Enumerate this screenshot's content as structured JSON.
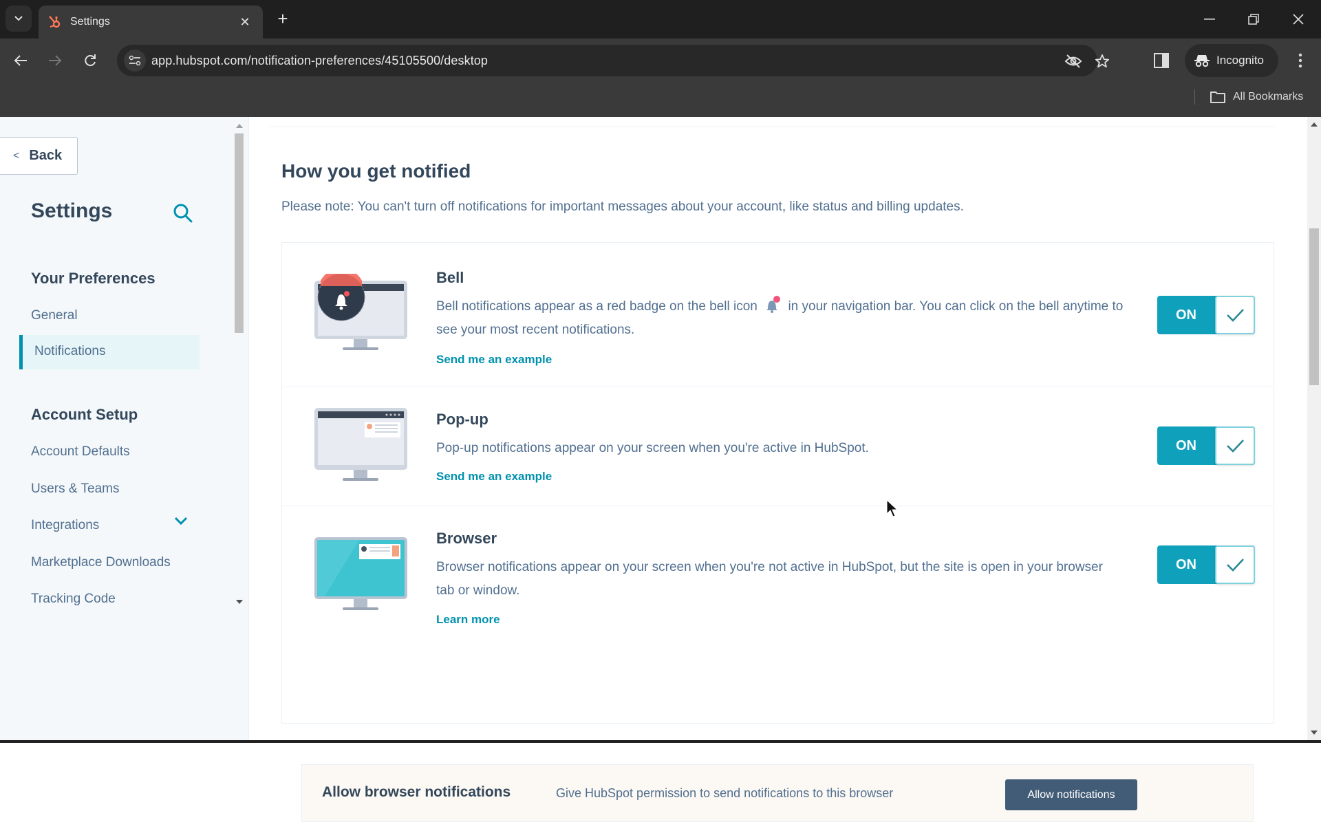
{
  "browser": {
    "tab_title": "Settings",
    "url": "app.hubspot.com/notification-preferences/45105500/desktop",
    "profile_label": "Incognito",
    "bookmarks_label": "All Bookmarks"
  },
  "sidebar": {
    "back_label": "Back",
    "title": "Settings",
    "sections": [
      {
        "label": "Your Preferences",
        "items": [
          {
            "label": "General"
          },
          {
            "label": "Notifications",
            "active": true
          }
        ]
      },
      {
        "label": "Account Setup",
        "items": [
          {
            "label": "Account Defaults"
          },
          {
            "label": "Users & Teams"
          },
          {
            "label": "Integrations",
            "expandable": true
          },
          {
            "label": "Marketplace Downloads"
          },
          {
            "label": "Tracking Code"
          }
        ]
      }
    ]
  },
  "main": {
    "heading": "How you get notified",
    "note": "Please note: You can't turn off notifications for important messages about your account, like status and billing updates.",
    "channels": [
      {
        "title": "Bell",
        "desc_before_icon": "Bell notifications appear as a red badge on the bell icon",
        "desc_after_icon": "in your navigation bar. You can click on the bell anytime to see your most recent notifications.",
        "link": "Send me an example",
        "toggle_label": "ON",
        "enabled": true
      },
      {
        "title": "Pop-up",
        "desc": "Pop-up notifications appear on your screen when you're active in HubSpot.",
        "link": "Send me an example",
        "toggle_label": "ON",
        "enabled": true
      },
      {
        "title": "Browser",
        "desc": "Browser notifications appear on your screen when you're not active in HubSpot, but the site is open in your browser tab or window.",
        "link": "Learn more",
        "toggle_label": "ON",
        "enabled": true
      }
    ],
    "allow_box": {
      "title": "Allow browser notifications",
      "desc": "Give HubSpot permission to send notifications to this browser",
      "button": "Allow notifications"
    }
  },
  "colors": {
    "accent": "#0091ae",
    "toggle_on": "#0fa1bc",
    "text_dark": "#33475b",
    "text_muted": "#516f90",
    "button_dark": "#425b76",
    "hubspot_orange": "#ff7a59",
    "badge_red": "#f2545b"
  }
}
